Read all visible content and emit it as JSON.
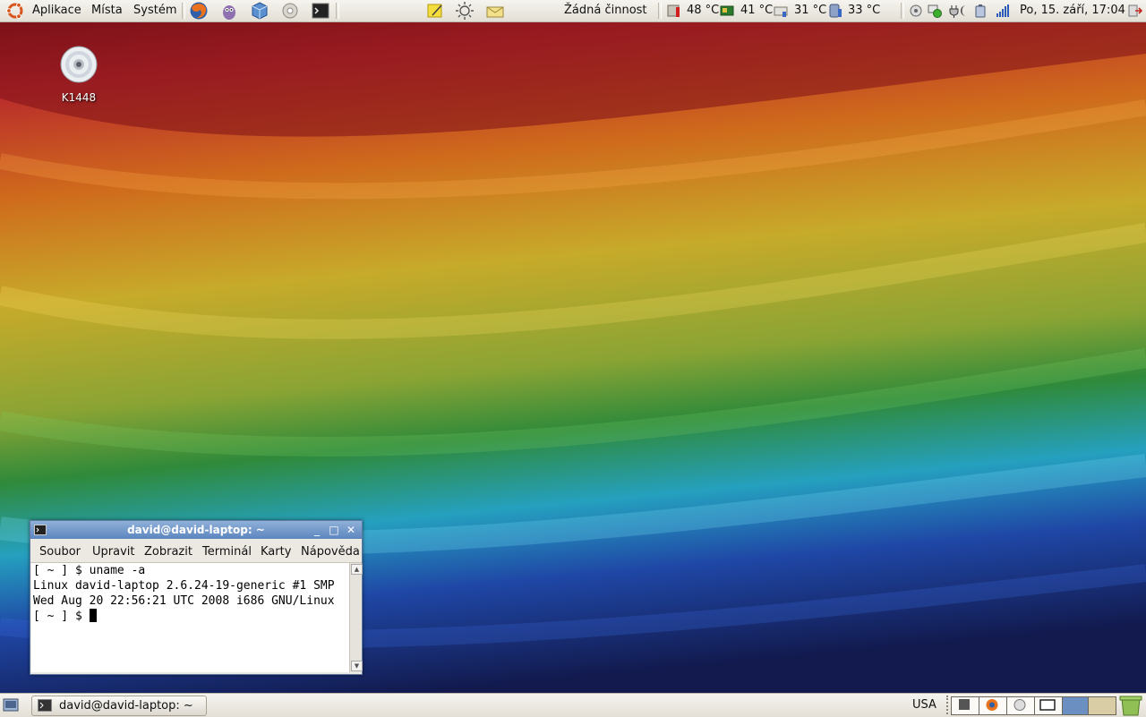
{
  "top_panel": {
    "menus": [
      "Aplikace",
      "Místa",
      "Systém"
    ],
    "activity": "Žádná činnost",
    "temps": [
      "48 °C",
      "41 °C",
      "31 °C",
      "33 °C"
    ],
    "clock": "Po, 15. září, 17:04"
  },
  "desktop": {
    "icons": [
      {
        "label": "K1448",
        "icon": "cd-icon"
      }
    ]
  },
  "terminal": {
    "title": "david@david-laptop: ~",
    "menus": [
      "Soubor",
      "Upravit",
      "Zobrazit",
      "Terminál",
      "Karty",
      "Nápověda"
    ],
    "lines": [
      "[ ~ ] $ uname -a",
      "Linux david-laptop 2.6.24-19-generic #1 SMP",
      "Wed Aug 20 22:56:21 UTC 2008 i686 GNU/Linux",
      "[ ~ ] $ "
    ]
  },
  "bottom_panel": {
    "task": "david@david-laptop: ~",
    "keyboard_layout": "USA"
  },
  "colors": {
    "panel_bg": "#ece9e2",
    "titlebar": "#6f94c8",
    "wallpaper": [
      "#7a1018",
      "#c9352e",
      "#d9841c",
      "#c9b12a",
      "#3f8f3a",
      "#2a9bbf",
      "#1d3f9c",
      "#141d52"
    ]
  }
}
